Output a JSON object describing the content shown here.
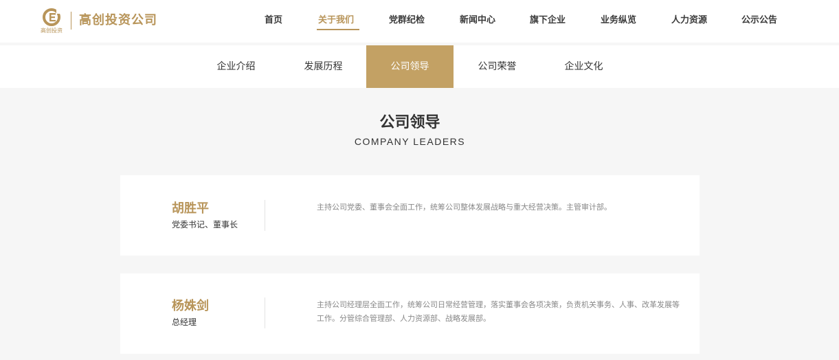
{
  "header": {
    "logo_sub": "高创投资",
    "brand": "高创投资公司"
  },
  "nav": {
    "items": [
      "首页",
      "关于我们",
      "党群纪检",
      "新闻中心",
      "旗下企业",
      "业务纵览",
      "人力资源",
      "公示公告"
    ],
    "active": "关于我们"
  },
  "subnav": {
    "items": [
      "企业介绍",
      "发展历程",
      "公司领导",
      "公司荣誉",
      "企业文化"
    ],
    "active": "公司领导"
  },
  "section": {
    "title": "公司领导",
    "subtitle": "COMPANY LEADERS"
  },
  "leaders": [
    {
      "name": "胡胜平",
      "role": "党委书记、董事长",
      "desc": "主持公司党委、董事会全面工作，统筹公司整体发展战略与重大经营决策。主管审计部。"
    },
    {
      "name": "杨姝剑",
      "role": "总经理",
      "desc": "主持公司经理层全面工作，统筹公司日常经营管理，落实董事会各项决策，负责机关事务、人事、改革发展等工作。分管综合管理部、人力资源部、战略发展部。"
    }
  ],
  "colors": {
    "accent": "#b8955a",
    "active_tab": "#c3a164",
    "page_bg": "#f6f6f6"
  }
}
